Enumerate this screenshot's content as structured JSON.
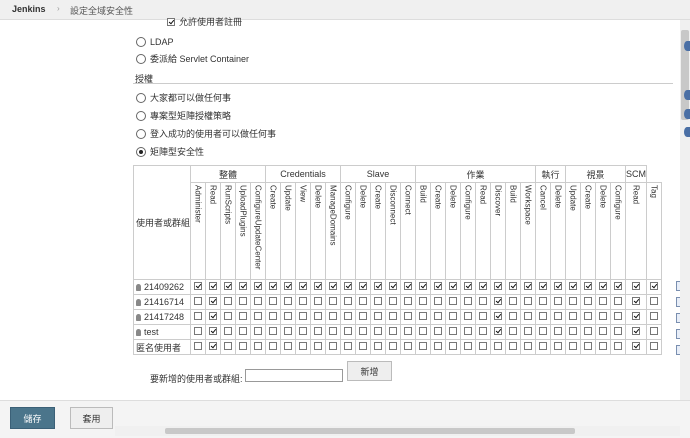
{
  "header": {
    "app_name": "Jenkins",
    "separator": "›",
    "breadcrumb": "設定全域安全性"
  },
  "allow_signup": {
    "label": "允許使用者註冊",
    "checked": true
  },
  "security_realm": [
    {
      "label": "LDAP",
      "selected": false
    },
    {
      "label": "委派給 Servlet Container",
      "selected": false
    }
  ],
  "authorization": {
    "title": "授權",
    "options": [
      {
        "label": "大家都可以做任何事",
        "selected": false
      },
      {
        "label": "專案型矩陣授權策略",
        "selected": false
      },
      {
        "label": "登入成功的使用者可以做任何事",
        "selected": false
      },
      {
        "label": "矩陣型安全性",
        "selected": true
      }
    ]
  },
  "matrix": {
    "user_header": "使用者或群組",
    "groups": [
      {
        "name": "整體",
        "span": 5
      },
      {
        "name": "Credentials",
        "span": 5
      },
      {
        "name": "Slave",
        "span": 5
      },
      {
        "name": "作業",
        "span": 8
      },
      {
        "name": "執行",
        "span": 2
      },
      {
        "name": "視景",
        "span": 4
      },
      {
        "name": "SCM",
        "span": 1
      }
    ],
    "permissions": [
      "Administer",
      "Read",
      "RunScripts",
      "UploadPlugins",
      "ConfigureUpdateCenter",
      "Create",
      "Update",
      "View",
      "Delete",
      "ManageDomains",
      "Configure",
      "Delete",
      "Create",
      "Disconnect",
      "Connect",
      "Build",
      "Create",
      "Delete",
      "Configure",
      "Read",
      "Discover",
      "Build",
      "Workspace",
      "Cancel",
      "Delete",
      "Update",
      "Create",
      "Delete",
      "Configure",
      "Read",
      "Tag"
    ],
    "rows": [
      {
        "name": "21409262",
        "checks": [
          1,
          1,
          1,
          1,
          1,
          1,
          1,
          1,
          1,
          1,
          1,
          1,
          1,
          1,
          1,
          1,
          1,
          1,
          1,
          1,
          1,
          1,
          1,
          1,
          1,
          1,
          1,
          1,
          1,
          1,
          1
        ]
      },
      {
        "name": "21416714",
        "checks": [
          0,
          1,
          0,
          0,
          0,
          0,
          0,
          0,
          0,
          0,
          0,
          0,
          0,
          0,
          0,
          0,
          0,
          0,
          0,
          0,
          1,
          0,
          0,
          0,
          0,
          0,
          0,
          0,
          0,
          1,
          0
        ]
      },
      {
        "name": "21417248",
        "checks": [
          0,
          1,
          0,
          0,
          0,
          0,
          0,
          0,
          0,
          0,
          0,
          0,
          0,
          0,
          0,
          0,
          0,
          0,
          0,
          0,
          1,
          0,
          0,
          0,
          0,
          0,
          0,
          0,
          0,
          1,
          0
        ]
      },
      {
        "name": "test",
        "checks": [
          0,
          1,
          0,
          0,
          0,
          0,
          0,
          0,
          0,
          0,
          0,
          0,
          0,
          0,
          0,
          0,
          0,
          0,
          0,
          0,
          1,
          0,
          0,
          0,
          0,
          0,
          0,
          0,
          0,
          1,
          0
        ]
      },
      {
        "name": "匿名使用者",
        "checks": [
          0,
          1,
          0,
          0,
          0,
          0,
          0,
          0,
          0,
          0,
          0,
          0,
          0,
          0,
          0,
          0,
          0,
          0,
          0,
          0,
          0,
          0,
          0,
          0,
          0,
          0,
          0,
          0,
          0,
          1,
          0
        ]
      }
    ]
  },
  "add_user": {
    "label": "要新增的使用者或群組:",
    "input_value": "",
    "button_label": "新增"
  },
  "footer": {
    "save_label": "儲存",
    "apply_label": "套用"
  },
  "colors": {
    "save_button": "#4b758b",
    "help_icon": "#4a6fa5"
  }
}
